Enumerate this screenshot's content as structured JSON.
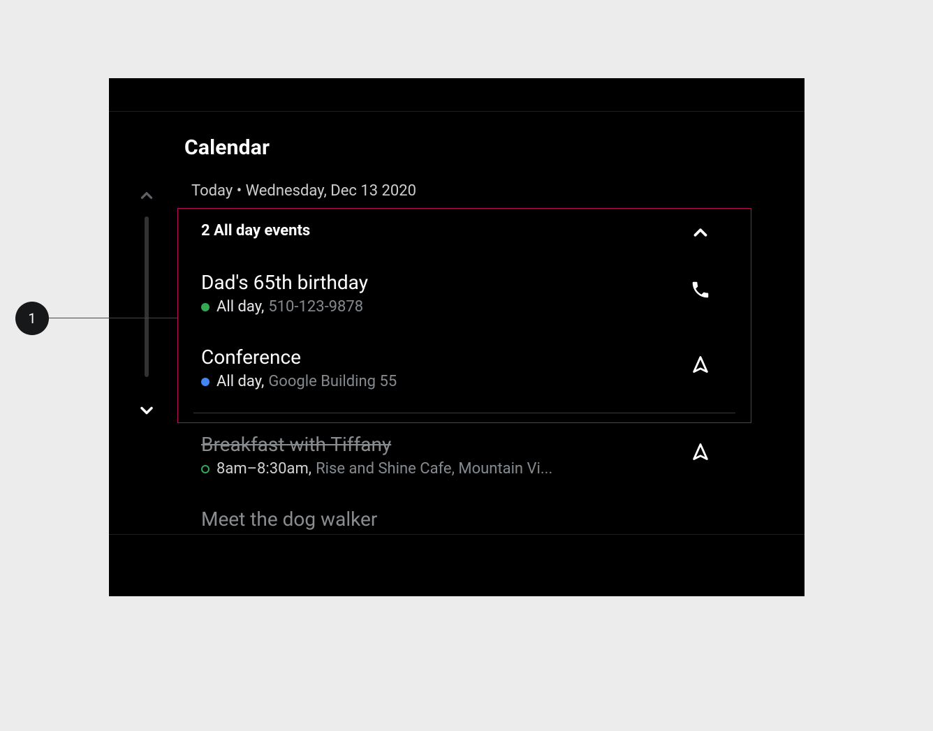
{
  "callout": {
    "number": "1"
  },
  "header": {
    "app_title": "Calendar",
    "date_line": "Today • Wednesday, Dec 13 2020"
  },
  "allday_section": {
    "header_label": "2 All day events",
    "events": [
      {
        "title": "Dad's 65th birthday",
        "time_label": "All day,",
        "detail": "510-123-9878",
        "dot_color": "green",
        "action_icon": "phone"
      },
      {
        "title": "Conference",
        "time_label": "All day,",
        "detail": "Google Building 55",
        "dot_color": "blue",
        "action_icon": "navigate"
      }
    ]
  },
  "timed_events": [
    {
      "title": "Breakfast with Tiffany",
      "strike": true,
      "time_label": "8am–8:30am,",
      "detail": "Rise and Shine Cafe, Mountain Vi...",
      "dot_style": "green-open",
      "action_icon": "navigate"
    },
    {
      "title": "Meet the dog walker"
    }
  ]
}
